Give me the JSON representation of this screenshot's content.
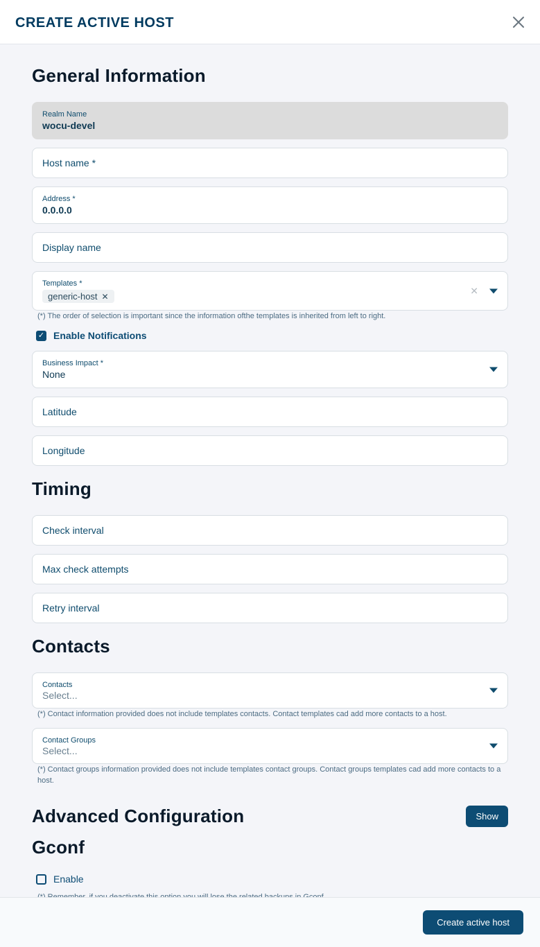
{
  "modal": {
    "title": "CREATE ACTIVE HOST"
  },
  "sections": {
    "general": "General Information",
    "timing": "Timing",
    "contacts": "Contacts",
    "advanced": "Advanced Configuration",
    "gconf": "Gconf"
  },
  "fields": {
    "realm": {
      "label": "Realm Name",
      "value": "wocu-devel"
    },
    "hostname": {
      "label": "Host name *"
    },
    "address": {
      "label": "Address *",
      "value": "0.0.0.0"
    },
    "displayname": {
      "label": "Display name"
    },
    "templates": {
      "label": "Templates *",
      "chips": [
        "generic-host"
      ],
      "help": "(*) The order of selection is important since the information ofthe templates is inherited from left to right."
    },
    "notifications": {
      "label": "Enable Notifications",
      "checked": true
    },
    "businessimpact": {
      "label": "Business Impact *",
      "value": "None"
    },
    "latitude": {
      "label": "Latitude"
    },
    "longitude": {
      "label": "Longitude"
    },
    "checkinterval": {
      "label": "Check interval"
    },
    "maxcheckattempts": {
      "label": "Max check attempts"
    },
    "retryinterval": {
      "label": "Retry interval"
    },
    "contacts_select": {
      "label": "Contacts",
      "placeholder": "Select...",
      "help": "(*) Contact information provided does not include templates contacts. Contact templates cad add more contacts to a host."
    },
    "contactgroups_select": {
      "label": "Contact Groups",
      "placeholder": "Select...",
      "help": "(*) Contact groups information provided does not include templates contact groups. Contact groups templates cad add more contacts to a host."
    },
    "gconf_enable": {
      "label": "Enable",
      "checked": false,
      "help": "(*) Remember, if you deactivate this option you will lose the related backups in Gconf"
    }
  },
  "buttons": {
    "show": "Show",
    "submit": "Create active host"
  }
}
